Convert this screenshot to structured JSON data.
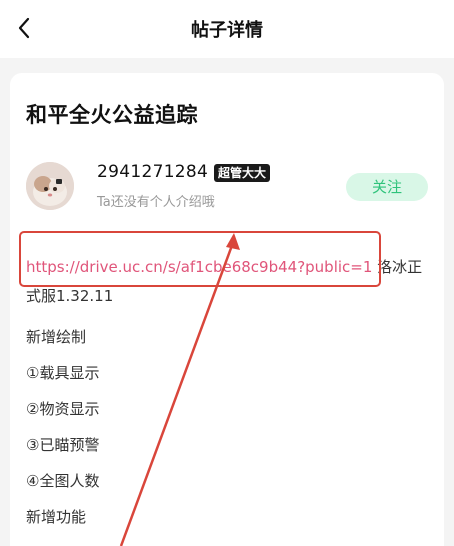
{
  "header": {
    "title": "帖子详情"
  },
  "post": {
    "title": "和平全火公益追踪",
    "author": {
      "name": "2941271284",
      "badge": "超管大大",
      "bio": "Ta还没有个人介绍哦"
    },
    "follow_label": "关注",
    "link_url": "https://drive.uc.cn/s/af1cbe68c9b44?public=1",
    "link_suffix": " 洛冰正式服1.32.11",
    "lines": [
      "新增绘制",
      "①载具显示",
      "②物资显示",
      "③已瞄预警",
      "④全图人数",
      "新增功能"
    ]
  },
  "colors": {
    "accent_green": "#2fc37b",
    "follow_bg": "#d9f7e7",
    "link_pink": "#e0557a",
    "annotation_red": "#d9463b"
  }
}
